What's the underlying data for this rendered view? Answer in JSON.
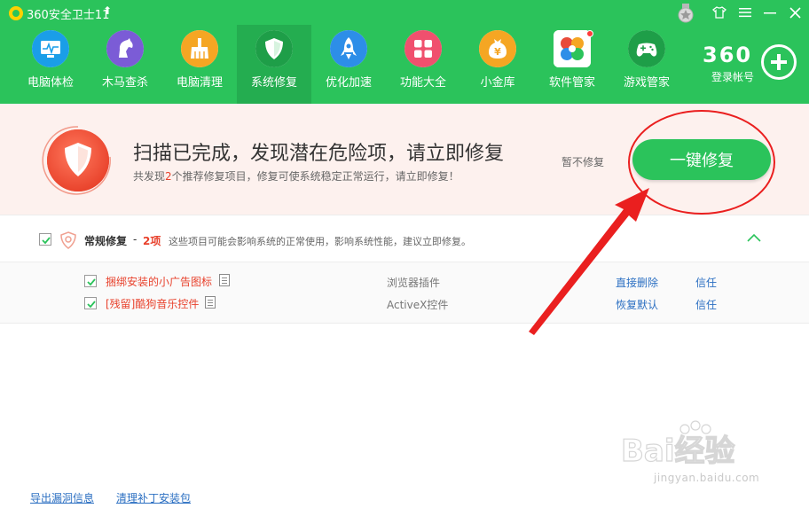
{
  "titlebar": {
    "app_title": "360安全卫士11",
    "update_icon": "up-arrow-icon",
    "buttons": [
      "medal-icon",
      "skin-icon",
      "menu-icon",
      "minimize-icon",
      "close-icon"
    ]
  },
  "nav": {
    "items": [
      {
        "label": "电脑体检",
        "icon": "monitor-icon",
        "color": "#1a9ee8"
      },
      {
        "label": "木马查杀",
        "icon": "horse-icon",
        "color": "#7b5cd6"
      },
      {
        "label": "电脑清理",
        "icon": "broom-icon",
        "color": "#f5a623"
      },
      {
        "label": "系统修复",
        "icon": "shield-icon",
        "color": "#1e9e48"
      },
      {
        "label": "优化加速",
        "icon": "rocket-icon",
        "color": "#2d8ee8"
      },
      {
        "label": "功能大全",
        "icon": "grid-icon",
        "color": "#f0506e"
      },
      {
        "label": "小金库",
        "icon": "coin-icon",
        "color": "#f5a623"
      },
      {
        "label": "软件管家",
        "icon": "flower-icon",
        "color": "#e84b3a"
      },
      {
        "label": "游戏管家",
        "icon": "gamepad-icon",
        "color": "#1e9e48"
      }
    ],
    "active_index": 3
  },
  "account": {
    "brand": "360",
    "login_label": "登录帐号"
  },
  "banner": {
    "title": "扫描已完成，发现潜在危险项，请立即修复",
    "desc_prefix": "共发现",
    "desc_count": "2",
    "desc_suffix": "个推荐修复项目，修复可使系统稳定正常运行，请立即修复！",
    "skip_label": "暂不修复",
    "fix_button": "一键修复"
  },
  "section": {
    "title": "常规修复",
    "dash": "-",
    "count": "2项",
    "desc": "这些项目可能会影响系统的正常使用，影响系统性能，建议立即修复。"
  },
  "items": [
    {
      "name": "捆绑安装的小广告图标",
      "type": "浏览器插件",
      "action": "直接删除",
      "trust": "信任"
    },
    {
      "name": "[残留]酷狗音乐控件",
      "type": "ActiveX控件",
      "action": "恢复默认",
      "trust": "信任"
    }
  ],
  "footer": {
    "export_link": "导出漏洞信息",
    "clean_link": "清理补丁安装包"
  },
  "watermark": {
    "logo_text": "Bai经验",
    "url": "jingyan.baidu.com"
  },
  "colors": {
    "header_green": "#2bc35b",
    "danger_red": "#e8412c",
    "link_blue": "#2b6fc2",
    "annotation_red": "#ea1f1f"
  }
}
